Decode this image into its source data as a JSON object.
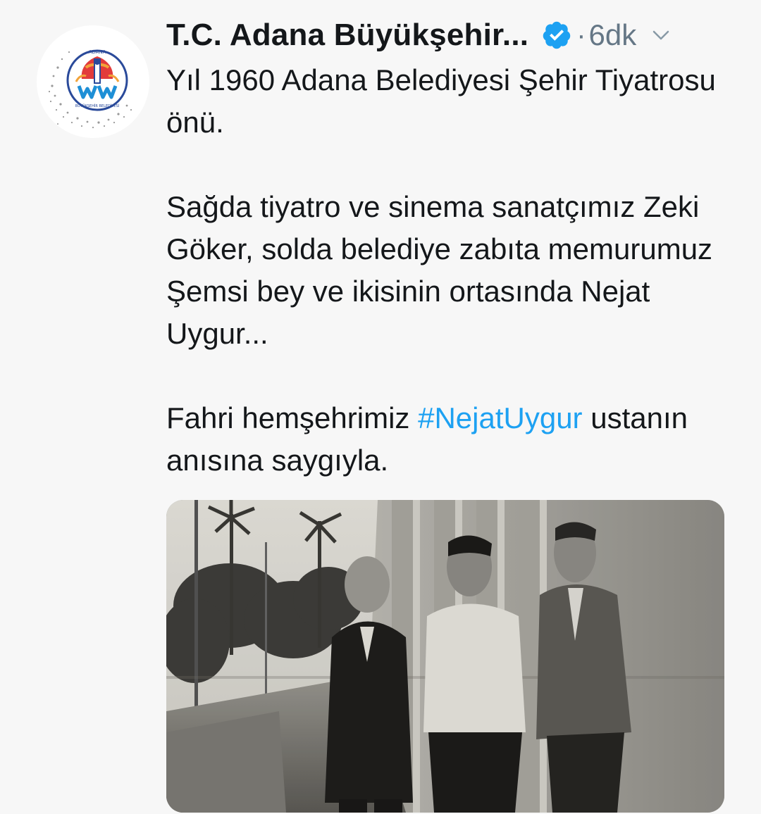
{
  "tweet": {
    "author": {
      "display_name": "T.C. Adana Büyükşehir...",
      "verified": true,
      "avatar_icon": "adana-municipality-logo",
      "logo_lettering": [
        "ADANA",
        "BÜYÜKŞEHİR BELEDİYESİ"
      ]
    },
    "separator": "·",
    "timestamp": "6dk",
    "menu_icon": "chevron-down-icon",
    "text": {
      "line_1": "Yıl 1960 Adana Belediyesi Şehir Tiyatrosu önü.",
      "line_2": "Sağda tiyatro ve sinema sanatçımız Zeki Göker, solda belediye zabıta memurumuz Şemsi bey ve ikisinin ortasında Nejat Uygur...",
      "line_3_prefix": "Fahri hemşehrimiz ",
      "hashtag": "#NejatUygur",
      "line_3_suffix": " ustanın anısına saygıyla."
    },
    "media": {
      "type": "photo",
      "description_icon": "black-and-white-photo"
    },
    "colors": {
      "text": "#14171a",
      "secondary": "#657786",
      "link": "#1da1f2",
      "verified_badge": "#1da1f2",
      "background": "#f7f7f7"
    }
  }
}
